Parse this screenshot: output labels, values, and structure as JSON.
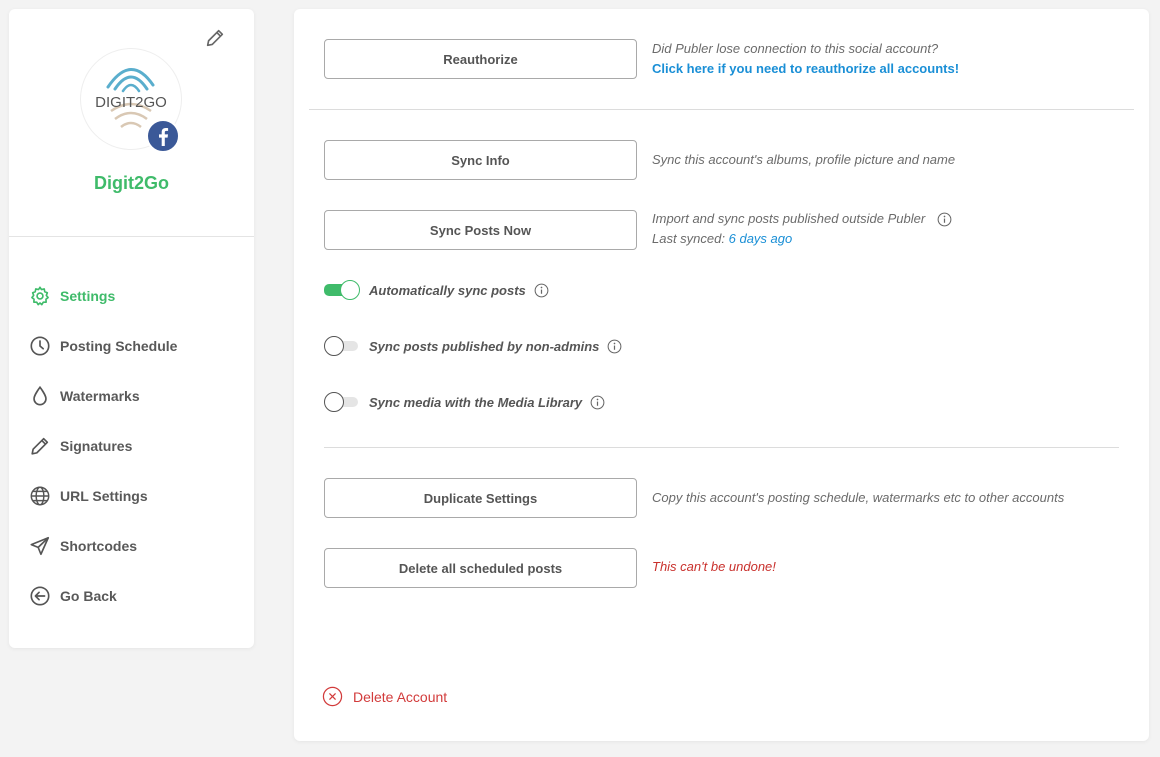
{
  "profile": {
    "name": "Digit2Go",
    "logo_text": "DIGIT2GO"
  },
  "menu": [
    {
      "label": "Settings",
      "icon": "gear-icon",
      "active": true
    },
    {
      "label": "Posting Schedule",
      "icon": "clock-icon",
      "active": false
    },
    {
      "label": "Watermarks",
      "icon": "drop-icon",
      "active": false
    },
    {
      "label": "Signatures",
      "icon": "pencil-icon",
      "active": false
    },
    {
      "label": "URL Settings",
      "icon": "globe-icon",
      "active": false
    },
    {
      "label": "Shortcodes",
      "icon": "paper-plane-icon",
      "active": false
    },
    {
      "label": "Go Back",
      "icon": "arrow-left-circle-icon",
      "active": false
    }
  ],
  "actions": {
    "reauthorize": {
      "button": "Reauthorize",
      "desc_line1": "Did Publer lose connection to this social account?",
      "desc_link": "Click here if you need to reauthorize all accounts!"
    },
    "sync_info": {
      "button": "Sync Info",
      "desc": "Sync this account's albums, profile picture and name"
    },
    "sync_posts": {
      "button": "Sync Posts Now",
      "desc_line1": "Import and sync posts published outside Publer",
      "desc_last_label": "Last synced:",
      "desc_last_value": "6 days ago"
    },
    "duplicate": {
      "button": "Duplicate Settings",
      "desc": "Copy this account's posting schedule, watermarks etc to other accounts"
    },
    "delete_scheduled": {
      "button": "Delete all scheduled posts",
      "desc": "This can't be undone!"
    }
  },
  "toggles": [
    {
      "label": "Automatically sync posts",
      "on": true
    },
    {
      "label": "Sync posts published by non-admins",
      "on": false
    },
    {
      "label": "Sync media with the Media Library",
      "on": false
    }
  ],
  "delete_account": "Delete Account",
  "colors": {
    "accent_green": "#3fbb6a",
    "link_blue": "#1a8fd6",
    "danger_red": "#d23b3b",
    "facebook_blue": "#3b5998"
  }
}
